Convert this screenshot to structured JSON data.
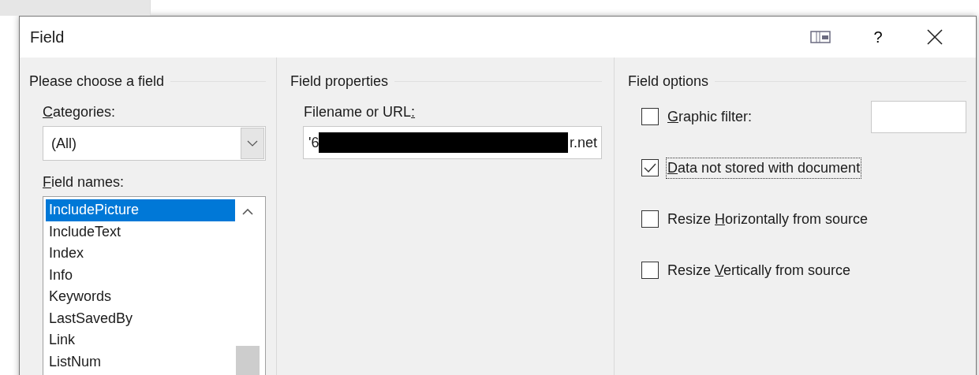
{
  "window": {
    "title": "Field"
  },
  "title_buttons": [
    {
      "kind": "restore"
    },
    {
      "kind": "help",
      "label": "?"
    },
    {
      "kind": "close"
    }
  ],
  "choose_panel": {
    "heading": "Please choose a field",
    "categories": {
      "label": {
        "key": "C",
        "post": "ategories:"
      },
      "value": "(All)"
    },
    "field_names": {
      "label": {
        "key": "F",
        "post": "ield names:"
      },
      "items": [
        {
          "label": "IncludePicture",
          "selected": true
        },
        {
          "label": "IncludeText",
          "selected": false
        },
        {
          "label": "Index",
          "selected": false
        },
        {
          "label": "Info",
          "selected": false
        },
        {
          "label": "Keywords",
          "selected": false
        },
        {
          "label": "LastSavedBy",
          "selected": false
        },
        {
          "label": "Link",
          "selected": false
        },
        {
          "label": "ListNum",
          "selected": false
        }
      ]
    }
  },
  "properties_panel": {
    "heading": "Field properties",
    "filename": {
      "label": {
        "pre": "Filename or URL",
        "key": ":"
      },
      "value_start": "'6",
      "value_end": "r.net",
      "redacted": true
    }
  },
  "options_panel": {
    "heading": "Field options",
    "options": [
      {
        "kind": "text_input",
        "label": {
          "key": "G",
          "post": "raphic filter:"
        },
        "checked": false,
        "focused": false
      },
      {
        "kind": "plain",
        "label": {
          "key": "D",
          "post": "ata not stored with document"
        },
        "checked": true,
        "focused": true
      },
      {
        "kind": "plain",
        "label": {
          "pre": "Resize ",
          "key": "H",
          "post": "orizontally from source"
        },
        "checked": false,
        "focused": false
      },
      {
        "kind": "plain",
        "label": {
          "pre": "Resize ",
          "key": "V",
          "post": "ertically from source"
        },
        "checked": false,
        "focused": false
      }
    ]
  }
}
